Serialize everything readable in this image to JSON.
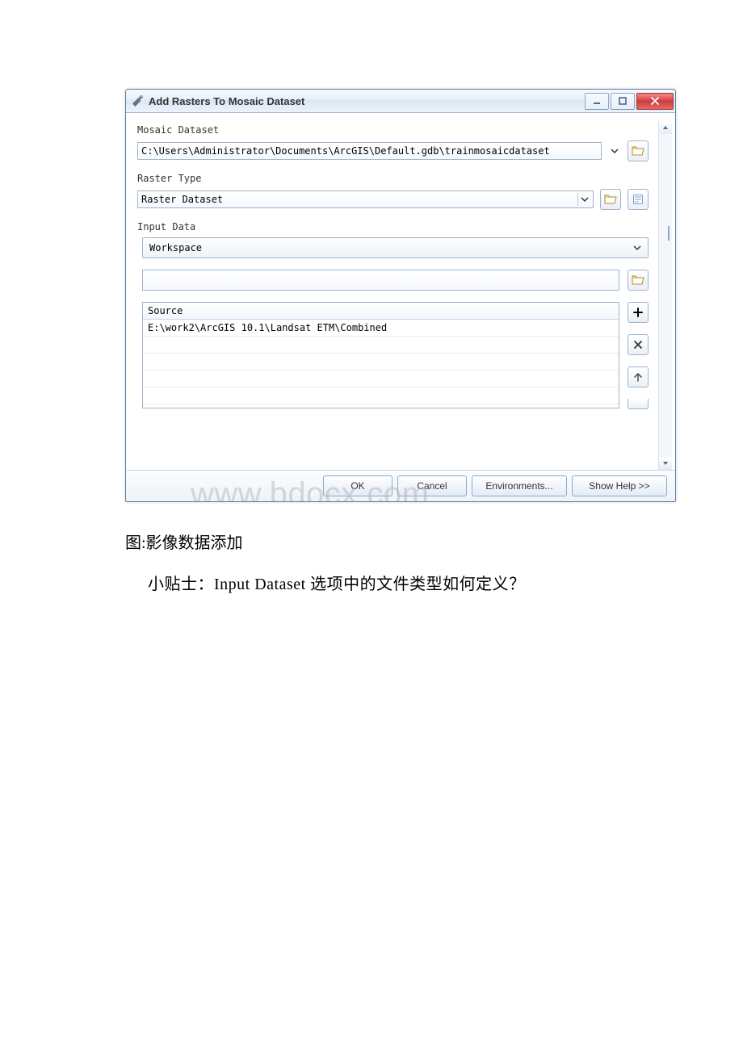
{
  "window": {
    "title": "Add Rasters To Mosaic Dataset"
  },
  "labels": {
    "mosaic_dataset": "Mosaic Dataset",
    "raster_type": "Raster Type",
    "input_data": "Input Data"
  },
  "fields": {
    "mosaic_dataset_path": "C:\\Users\\Administrator\\Documents\\ArcGIS\\Default.gdb\\trainmosaicdataset",
    "raster_type_value": "Raster Dataset",
    "input_data_type": "Workspace"
  },
  "list": {
    "header": "Source",
    "rows": [
      "E:\\work2\\ArcGIS 10.1\\Landsat ETM\\Combined"
    ]
  },
  "buttons": {
    "ok": "OK",
    "cancel": "Cancel",
    "environments": "Environments...",
    "show_help": "Show Help >>"
  },
  "captions": {
    "fig": "图:影像数据添加",
    "tip": "小贴士：Input Dataset 选项中的文件类型如何定义？"
  },
  "watermark": "www.bdocx.com"
}
